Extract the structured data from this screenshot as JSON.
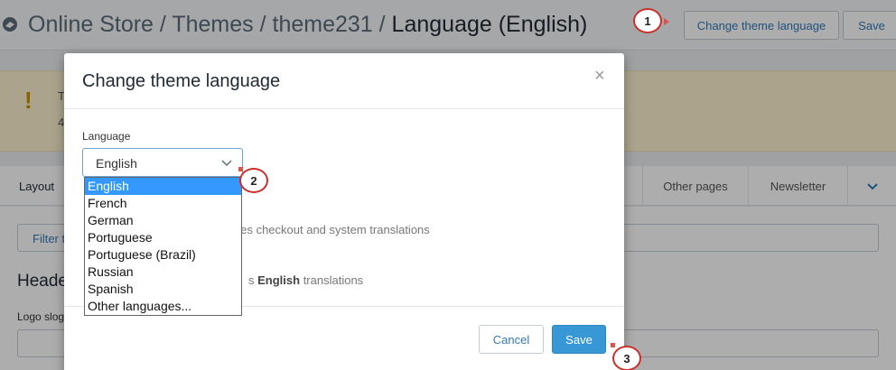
{
  "header": {
    "breadcrumb_path": "Online Store / Themes / theme231 /",
    "breadcrumb_current": "Language (English)",
    "change_language_label": "Change theme language",
    "save_label": "Save"
  },
  "banner": {
    "line1_fragment": "T",
    "line2_fragment": "4"
  },
  "tabs": {
    "layout": "Layout",
    "other_pages": "Other pages",
    "newsletter": "Newsletter"
  },
  "content": {
    "filter_placeholder": "Filter t",
    "header_title": "Heade",
    "logo_slogan_label": "Logo slog"
  },
  "modal": {
    "title": "Change theme language",
    "close_glyph": "×",
    "language_label": "Language",
    "selected_language": "English",
    "hint1": "des checkout and system translations",
    "hint2_prefix": "s ",
    "hint2_bold": "English",
    "hint2_suffix": " translations",
    "cancel_label": "Cancel",
    "save_label": "Save",
    "options": [
      "English",
      "French",
      "German",
      "Portuguese",
      "Portuguese (Brazil)",
      "Russian",
      "Spanish",
      "Other languages..."
    ]
  },
  "markers": [
    "1",
    "2",
    "3"
  ],
  "colors": {
    "primary": "#3898d6",
    "link": "#337ab7",
    "warning_banner": "#fcf1cd",
    "annotation": "#c9302c",
    "selected_option": "#3399ff"
  },
  "icons": {
    "logo": "shopify-logo-icon",
    "warning": "exclamation-icon",
    "select_chevron": "chevron-down-icon",
    "tabs_more": "chevron-down-icon",
    "close": "close-icon"
  }
}
